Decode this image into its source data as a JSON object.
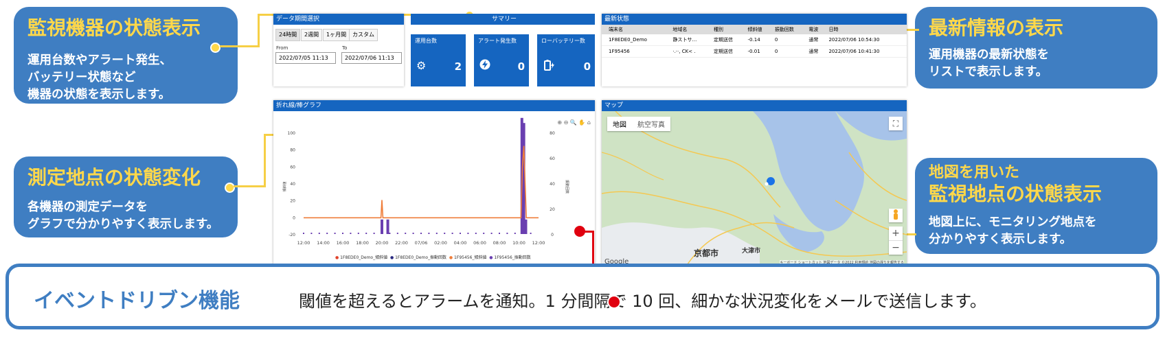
{
  "callouts": {
    "status": {
      "title": "監視機器の状態表示",
      "desc": "運用台数やアラート発生、\nバッテリー状態など\n機器の状態を表示します。"
    },
    "graph": {
      "title": "測定地点の状態変化",
      "desc": "各機器の測定データを\nグラフで分かりやすく表示します。"
    },
    "latest": {
      "title": "最新情報の表示",
      "desc": "運用機器の最新状態を\nリストで表示します。"
    },
    "map": {
      "title_line1": "地図を用いた",
      "title_line2": "監視地点の状態表示",
      "desc": "地図上に、モニタリング地点を\n分かりやすく表示します。"
    }
  },
  "data_period": {
    "header": "データ期間選択",
    "tabs": [
      "24時間",
      "2週間",
      "1ヶ月間",
      "カスタム"
    ],
    "from_label": "From",
    "to_label": "To",
    "from_value": "2022/07/05 11:13",
    "to_value": "2022/07/06 11:13"
  },
  "summary": {
    "header": "サマリー",
    "boxes": [
      {
        "label": "運用台数",
        "value": "2",
        "icon": "gear-icon"
      },
      {
        "label": "アラート発生数",
        "value": "0",
        "icon": "bolt-icon"
      },
      {
        "label": "ローバッテリー数",
        "value": "0",
        "icon": "battery-icon"
      }
    ]
  },
  "latest": {
    "header": "最新状態",
    "columns": [
      "端末名",
      "地域名",
      "種別",
      "傾斜値",
      "振動回数",
      "電波",
      "日時"
    ],
    "rows": [
      [
        "1F8EDE0_Demo",
        "静ス卜サ… ",
        "定期送信",
        "-0.14",
        "0",
        "通常",
        "2022/07/06 10:54:30"
      ],
      [
        "1F95456",
        "·.··, CK< .",
        "定期送信",
        "-0.01",
        "0",
        "通常",
        "2022/07/06 10:41:30"
      ]
    ]
  },
  "graph": {
    "header": "折れ線/棒グラフ",
    "y_left_label": "傾斜値",
    "y_right_label": "振動回数",
    "legend": [
      "1F8EDE0_Demo_傾斜値",
      "1F8EDE0_Demo_振動回数",
      "1F95456_傾斜値",
      "1F95456_振動回数"
    ],
    "tool_icons": [
      "⊕",
      "⊖",
      "🔍",
      "✋",
      "⌂"
    ]
  },
  "chart_data": {
    "type": "line",
    "x_ticks": [
      "12:00",
      "14:00",
      "16:00",
      "18:00",
      "20:00",
      "22:00",
      "07/06",
      "02:00",
      "04:00",
      "06:00",
      "08:00",
      "10:00",
      "12:00"
    ],
    "y_left_ticks": [
      100,
      80,
      60,
      40,
      20,
      0,
      -20
    ],
    "y_right_ticks": [
      80,
      60,
      40,
      20,
      0
    ],
    "ylim_left": [
      -20,
      100
    ],
    "ylim_right": [
      0,
      80
    ],
    "colors": {
      "tilt1": "#e0432b",
      "vib1": "#2a2a80",
      "tilt2": "#ef7d3a",
      "vib2": "#6a3fb0"
    },
    "tilt_line": {
      "x": [
        0,
        7.9,
        8.0,
        8.1,
        22.2,
        22.35,
        22.5,
        22.75,
        24
      ],
      "y": [
        0,
        0,
        21,
        0,
        0,
        60,
        85,
        0,
        0
      ]
    },
    "vib_bars": [
      {
        "x": 8.0,
        "value": 12
      },
      {
        "x": 8.6,
        "value": 12
      },
      {
        "x": 22.3,
        "value": 92
      },
      {
        "x": 22.5,
        "value": 88
      },
      {
        "x": 22.7,
        "value": 12
      }
    ],
    "grid": false
  },
  "map": {
    "header": "マップ",
    "tabs": [
      "地図",
      "航空写真"
    ],
    "city_kyoto": "京都市",
    "city_otsu": "大津市",
    "google": "Google",
    "attribution": "キーボード ショートカット  地図データ ©2022  利用規約  地図の誤りを報告する",
    "zoom_in": "+",
    "zoom_out": "−"
  },
  "event": {
    "title": "イベントドリブン機能",
    "text": "閾値を超えるとアラームを通知。1 分間隔で 10 回、細かな状況変化をメールで送信します。"
  }
}
